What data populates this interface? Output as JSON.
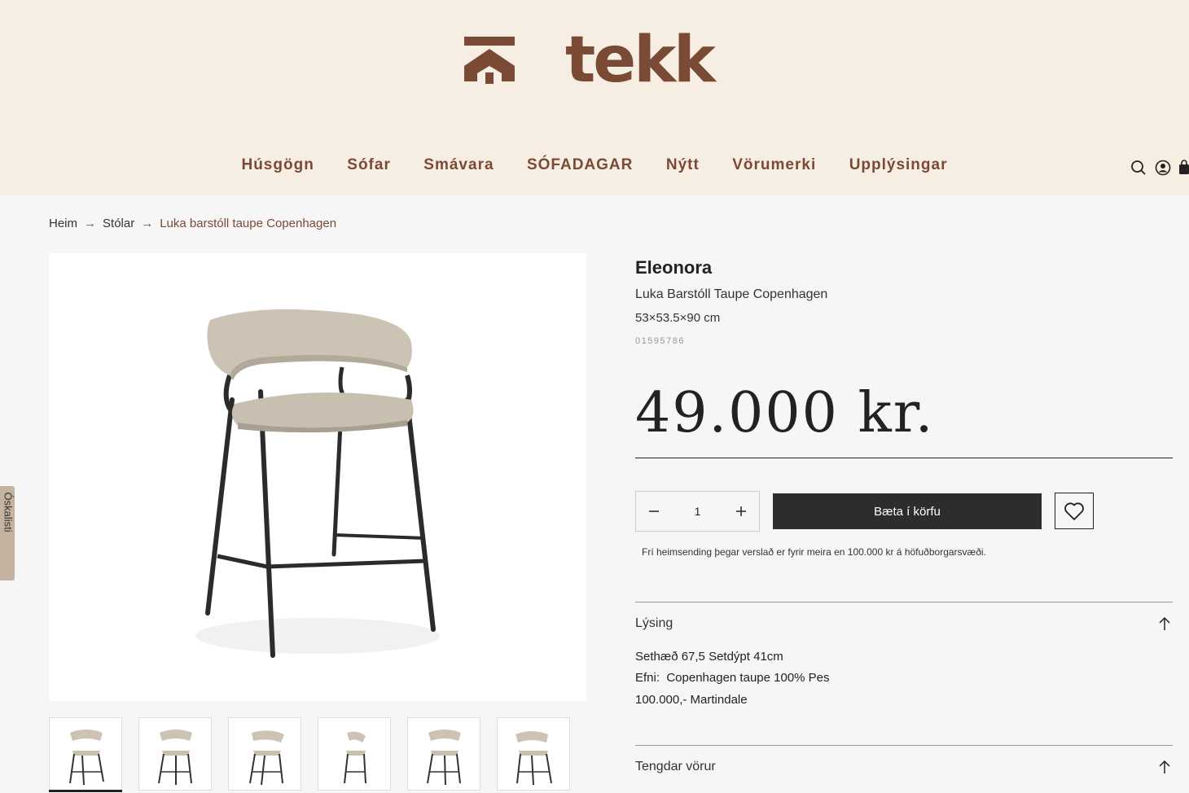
{
  "header": {
    "logo_text": "tekk",
    "nav": [
      "Húsgögn",
      "Sófar",
      "Smávara",
      "SÓFADAGAR",
      "Nýtt",
      "Vörumerki",
      "Upplýsingar"
    ],
    "icons": [
      "search-icon",
      "account-icon",
      "cart-icon"
    ]
  },
  "breadcrumb": {
    "items": [
      "Heim",
      "Stólar"
    ],
    "current": "Luka barstóll taupe Copenhagen"
  },
  "product": {
    "brand": "Eleonora",
    "name": "Luka Barstóll Taupe Copenhagen",
    "dimensions": "53×53.5×90 cm",
    "sku": "01595786",
    "price": "49.000 kr.",
    "quantity": "1",
    "add_to_cart": "Bæta í körfu",
    "shipping_note": "Frí heimsending þegar verslað er fyrir meira en 100.000 kr á höfuðborgarsvæði."
  },
  "accordion": {
    "description_title": "Lýsing",
    "description_lines": [
      "Sethæð 67,5 Setdýpt 41cm",
      "Efni:  Copenhagen taupe 100% Pes",
      "100.000,- Martindale"
    ],
    "related_title": "Tengdar vörur"
  },
  "side_tab": {
    "label": "Óskalisti"
  },
  "colors": {
    "brand_brown": "#7a4a34",
    "header_bg": "#f7eee3",
    "button_dark": "#2d2d2d"
  }
}
